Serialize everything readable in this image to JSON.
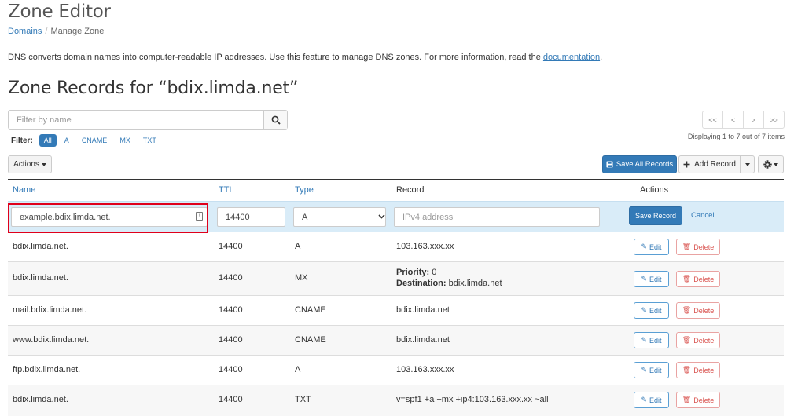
{
  "header": {
    "title": "Zone Editor",
    "breadcrumb": {
      "root": "Domains",
      "separator": "/",
      "current": "Manage Zone"
    }
  },
  "intro": {
    "text": "DNS converts domain names into computer-readable IP addresses. Use this feature to manage DNS zones. For more information, read the ",
    "link": "documentation",
    "tail": "."
  },
  "zone_title": "Zone Records for “bdix.limda.net”",
  "search": {
    "placeholder": "Filter by name",
    "value": ""
  },
  "filter": {
    "label": "Filter:",
    "chips": [
      "All",
      "A",
      "CNAME",
      "MX",
      "TXT"
    ],
    "active": "All"
  },
  "pager": {
    "first": "<<",
    "prev": "<",
    "next": ">",
    "last": ">>"
  },
  "display_count": "Displaying 1 to 7 out of 7 items",
  "toolbar": {
    "actions": "Actions",
    "save_all": "Save All Records",
    "add_record": "Add Record"
  },
  "table": {
    "headers": {
      "name": "Name",
      "ttl": "TTL",
      "type": "Type",
      "record": "Record",
      "actions": "Actions"
    },
    "new_record": {
      "name": "example.bdix.limda.net.",
      "ttl": "14400",
      "type": "A",
      "record_placeholder": "IPv4 address",
      "save": "Save Record",
      "cancel": "Cancel"
    },
    "edit_label": "Edit",
    "delete_label": "Delete",
    "rows": [
      {
        "name": "bdix.limda.net.",
        "ttl": "14400",
        "type": "A",
        "record": "103.163.xxx.xx"
      },
      {
        "name": "bdix.limda.net.",
        "ttl": "14400",
        "type": "MX",
        "priority_label": "Priority:",
        "priority": "0",
        "destination_label": "Destination:",
        "destination": "bdix.limda.net"
      },
      {
        "name": "mail.bdix.limda.net.",
        "ttl": "14400",
        "type": "CNAME",
        "record": "bdix.limda.net"
      },
      {
        "name": "www.bdix.limda.net.",
        "ttl": "14400",
        "type": "CNAME",
        "record": "bdix.limda.net"
      },
      {
        "name": "ftp.bdix.limda.net.",
        "ttl": "14400",
        "type": "A",
        "record": "103.163.xxx.xx"
      },
      {
        "name": "bdix.limda.net.",
        "ttl": "14400",
        "type": "TXT",
        "record": "v=spf1 +a +mx +ip4:103.163.xxx.xx ~all"
      }
    ]
  },
  "colors": {
    "primary": "#337ab7",
    "danger": "#d9534f",
    "edit_row_bg": "#d9ecf8",
    "highlight": "#e0001b"
  }
}
